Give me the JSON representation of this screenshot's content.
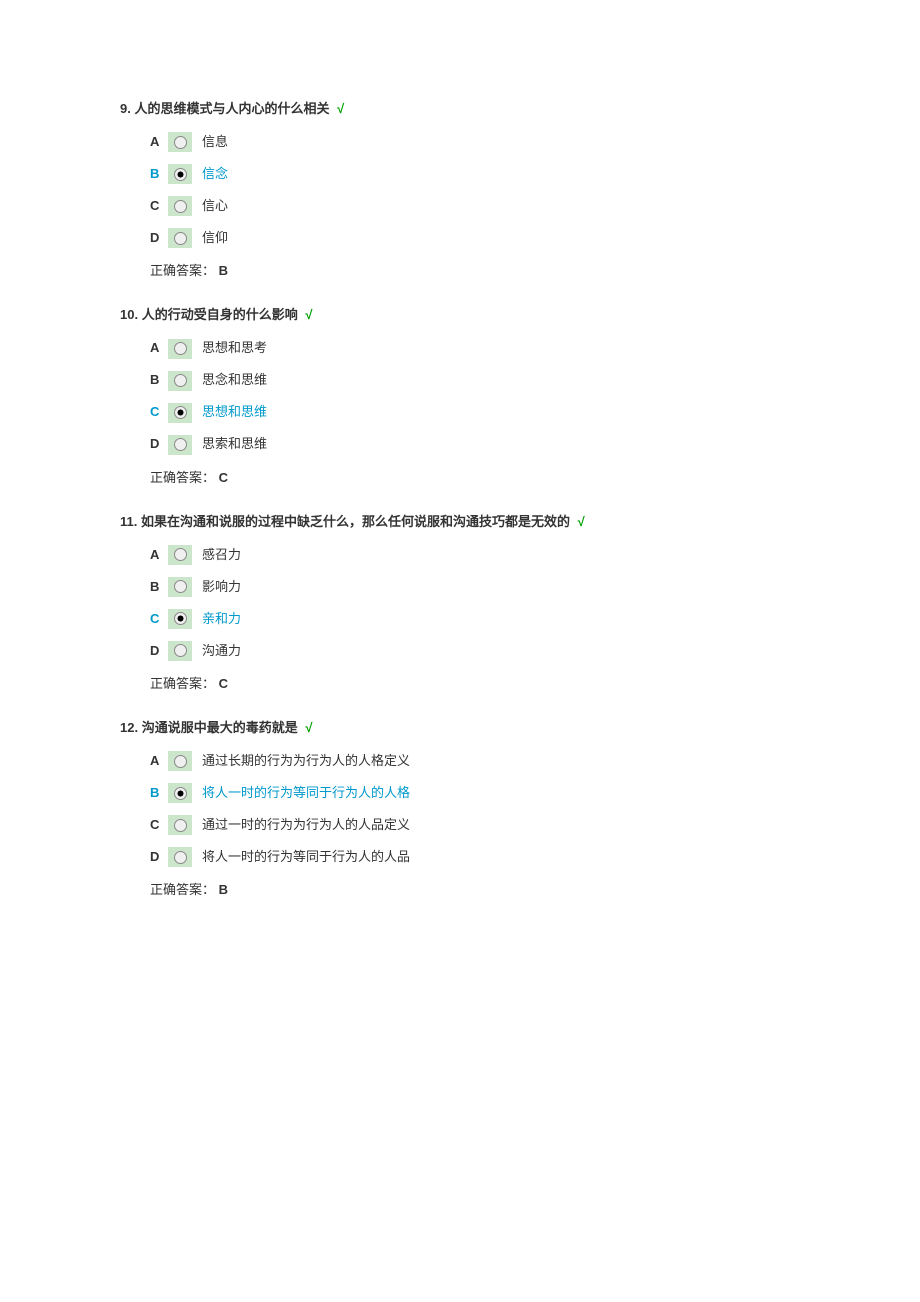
{
  "answer_label": "正确答案：",
  "questions": [
    {
      "num": "9.",
      "text": "人的思维模式与人内心的什么相关",
      "options": [
        {
          "letter": "A",
          "text": "信息",
          "selected": false,
          "correct": false
        },
        {
          "letter": "B",
          "text": "信念",
          "selected": true,
          "correct": true
        },
        {
          "letter": "C",
          "text": "信心",
          "selected": false,
          "correct": false
        },
        {
          "letter": "D",
          "text": "信仰",
          "selected": false,
          "correct": false
        }
      ],
      "answer": "B"
    },
    {
      "num": "10.",
      "text": "人的行动受自身的什么影响",
      "options": [
        {
          "letter": "A",
          "text": "思想和思考",
          "selected": false,
          "correct": false
        },
        {
          "letter": "B",
          "text": "思念和思维",
          "selected": false,
          "correct": false
        },
        {
          "letter": "C",
          "text": "思想和思维",
          "selected": true,
          "correct": true
        },
        {
          "letter": "D",
          "text": "思索和思维",
          "selected": false,
          "correct": false
        }
      ],
      "answer": "C"
    },
    {
      "num": "11.",
      "text": "如果在沟通和说服的过程中缺乏什么，那么任何说服和沟通技巧都是无效的",
      "options": [
        {
          "letter": "A",
          "text": "感召力",
          "selected": false,
          "correct": false
        },
        {
          "letter": "B",
          "text": "影响力",
          "selected": false,
          "correct": false
        },
        {
          "letter": "C",
          "text": "亲和力",
          "selected": true,
          "correct": true
        },
        {
          "letter": "D",
          "text": "沟通力",
          "selected": false,
          "correct": false
        }
      ],
      "answer": "C"
    },
    {
      "num": "12.",
      "text": "沟通说服中最大的毒药就是",
      "options": [
        {
          "letter": "A",
          "text": "通过长期的行为为行为人的人格定义",
          "selected": false,
          "correct": false
        },
        {
          "letter": "B",
          "text": "将人一时的行为等同于行为人的人格",
          "selected": true,
          "correct": true
        },
        {
          "letter": "C",
          "text": "通过一时的行为为行为人的人品定义",
          "selected": false,
          "correct": false
        },
        {
          "letter": "D",
          "text": "将人一时的行为等同于行为人的人品",
          "selected": false,
          "correct": false
        }
      ],
      "answer": "B"
    }
  ]
}
